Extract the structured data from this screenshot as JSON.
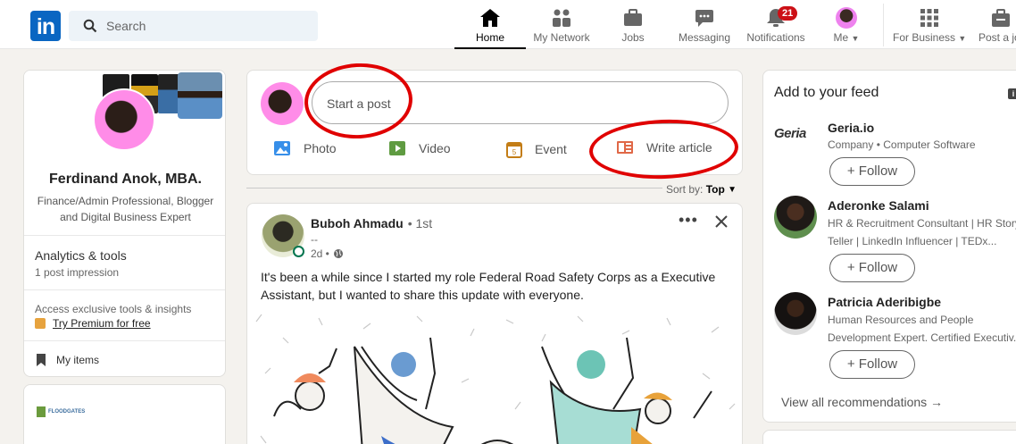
{
  "nav": {
    "logo": "in",
    "search_placeholder": "Search",
    "items": [
      {
        "label": "Home"
      },
      {
        "label": "My Network"
      },
      {
        "label": "Jobs"
      },
      {
        "label": "Messaging"
      },
      {
        "label": "Notifications",
        "badge": "21"
      },
      {
        "label": "Me"
      },
      {
        "label": "For Business"
      },
      {
        "label": "Post a jo"
      }
    ]
  },
  "profile": {
    "name": "Ferdinand Anok, MBA.",
    "headline": "Finance/Admin Professional, Blogger and Digital Business Expert",
    "analytics_title": "Analytics & tools",
    "analytics_sub": "1 post impression",
    "premium_text": "Access exclusive tools & insights",
    "premium_link": "Try Premium for free",
    "my_items": "My items",
    "card2_logo": "FLOODGATES"
  },
  "composer": {
    "placeholder": "Start a post",
    "photo": "Photo",
    "video": "Video",
    "event": "Event",
    "article": "Write article"
  },
  "sort": {
    "label": "Sort by:",
    "value": "Top"
  },
  "post": {
    "author": "Buboh Ahmadu",
    "degree": "• 1st",
    "subtitle": "--",
    "time": "2d •",
    "text": "It's been a while since I started my role Federal Road Safety Corps as a Executive Assistant, but I wanted to share this update with everyone."
  },
  "feed": {
    "title": "Add to your feed",
    "follow_label": "+ Follow",
    "recs": [
      {
        "name": "Geria.io",
        "logo": "Geria",
        "sub1": "Company • Computer Software",
        "sub2": ""
      },
      {
        "name": "Aderonke Salami",
        "sub1": "HR & Recruitment Consultant | HR Story",
        "sub2": "Teller | LinkedIn Influencer | TEDx..."
      },
      {
        "name": "Patricia Aderibigbe",
        "sub1": "Human Resources and People",
        "sub2": "Development Expert. Certified Executiv..."
      }
    ],
    "view_all": "View all recommendations →"
  },
  "colors": {
    "brand": "#0a66c2",
    "badge": "#cc1016",
    "annotation": "#e00000"
  }
}
